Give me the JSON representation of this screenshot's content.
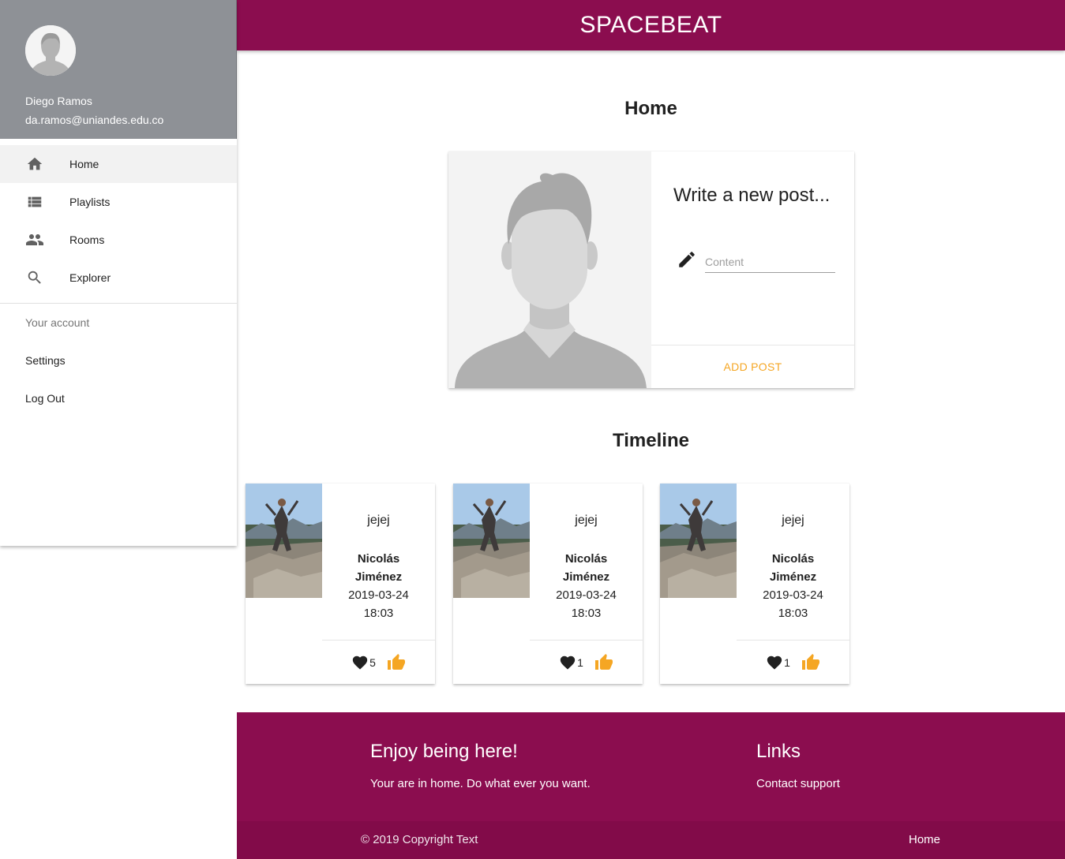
{
  "app": {
    "brand": "SPACEBEAT"
  },
  "user": {
    "name": "Diego Ramos",
    "email": "da.ramos@uniandes.edu.co"
  },
  "sidebar": {
    "nav": [
      {
        "label": "Home",
        "icon": "home-icon"
      },
      {
        "label": "Playlists",
        "icon": "list-icon"
      },
      {
        "label": "Rooms",
        "icon": "people-icon"
      },
      {
        "label": "Explorer",
        "icon": "search-icon"
      }
    ],
    "account_header": "Your account",
    "account_items": [
      {
        "label": "Settings"
      },
      {
        "label": "Log Out"
      }
    ]
  },
  "main": {
    "home_title": "Home",
    "new_post": {
      "title": "Write a new post...",
      "placeholder": "Content",
      "value": "",
      "button": "ADD POST"
    },
    "timeline_title": "Timeline",
    "timeline": [
      {
        "text": "jejej",
        "author": "Nicolás Jiménez",
        "date": "2019-03-24 18:03",
        "likes": "5"
      },
      {
        "text": "jejej",
        "author": "Nicolás Jiménez",
        "date": "2019-03-24 18:03",
        "likes": "1"
      },
      {
        "text": "jejej",
        "author": "Nicolás Jiménez",
        "date": "2019-03-24 18:03",
        "likes": "1"
      }
    ]
  },
  "footer": {
    "left_title": "Enjoy being here!",
    "left_text": "Your are in home. Do what ever you want.",
    "right_title": "Links",
    "right_link": "Contact support",
    "copyright": "© 2019 Copyright Text",
    "bottom_link": "Home"
  },
  "colors": {
    "primary": "#8b0d4f",
    "accent": "#f5a623",
    "sidebar_header": "#8e9196"
  }
}
